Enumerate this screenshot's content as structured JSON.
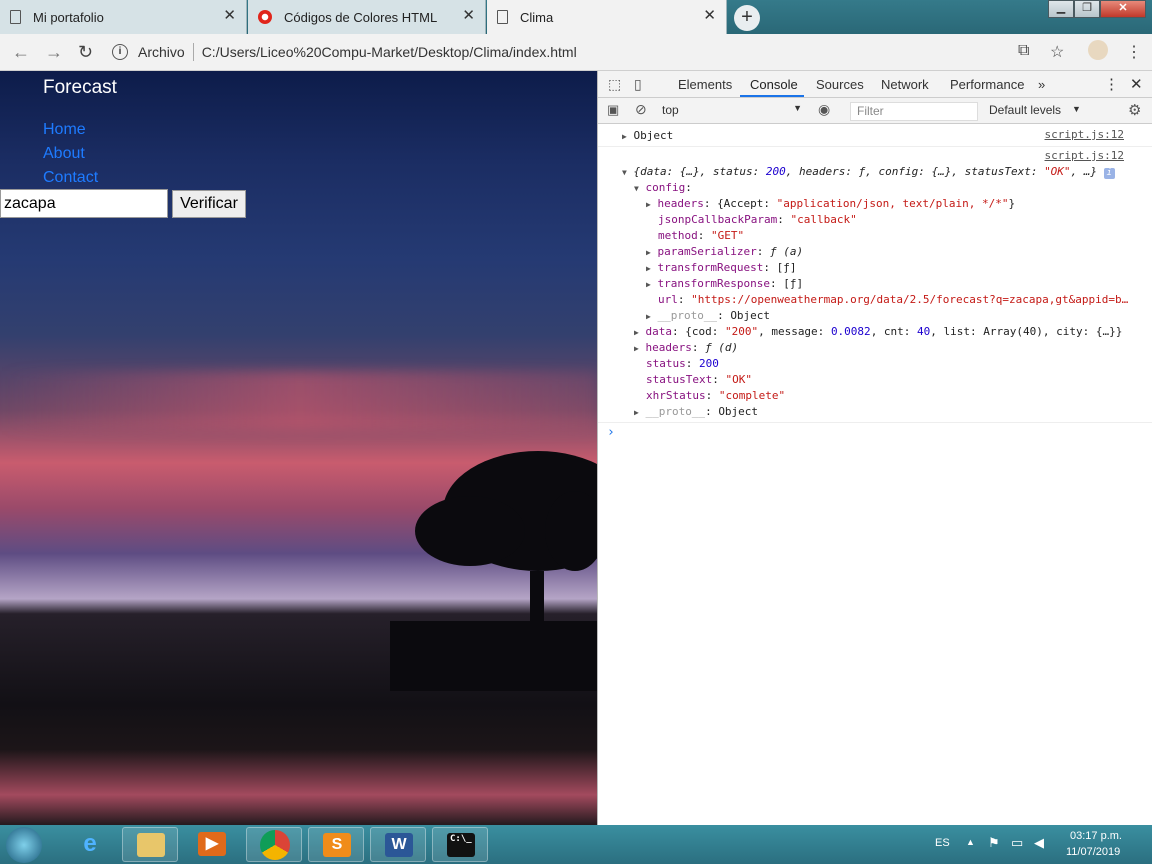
{
  "browser": {
    "tabs": [
      {
        "label": "Mi portafolio",
        "icon": "document-icon"
      },
      {
        "label": "Códigos de Colores HTML",
        "icon": "opera-icon"
      },
      {
        "label": "Clima",
        "icon": "document-icon"
      }
    ],
    "close_glyph": "✕",
    "new_tab_glyph": "+",
    "omnibox": {
      "scheme_label": "Archivo",
      "url": "C:/Users/Liceo%20Compu-Market/Desktop/Clima/index.html"
    }
  },
  "page": {
    "title": "Forecast",
    "nav": [
      "Home",
      "About",
      "Contact"
    ],
    "search_value": "zacapa",
    "button_label": "Verificar"
  },
  "devtools": {
    "tabs": [
      "Elements",
      "Console",
      "Sources",
      "Network",
      "Performance"
    ],
    "active_tab": "Console",
    "context": "top",
    "filter_placeholder": "Filter",
    "levels": "Default levels",
    "messages": {
      "src1": "script.js:12",
      "src2": "script.js:12",
      "line1": "Object",
      "summary_a": "{data: {…}, status: ",
      "summary_b": "200",
      "summary_c": ", headers: ƒ, config: {…}, statusText: ",
      "summary_d": "\"OK\"",
      "summary_e": ", …}",
      "config_key": "config",
      "headers_key": "headers",
      "headers_a": "{Accept: ",
      "headers_b": "\"application/json, text/plain, */*\"",
      "headers_c": "}",
      "jsonp_key": "jsonpCallbackParam",
      "jsonp_val": "\"callback\"",
      "method_key": "method",
      "method_val": "\"GET\"",
      "param_key": "paramSerializer",
      "param_val": "ƒ (a)",
      "treq_key": "transformRequest",
      "treq_val": "[ƒ]",
      "tres_key": "transformResponse",
      "tres_val": "[ƒ]",
      "url_key": "url",
      "url_val": "\"https://openweathermap.org/data/2.5/forecast?q=zacapa,gt&appid=b…",
      "proto_key": "__proto__",
      "proto_val": "Object",
      "data_key": "data",
      "data_a": "{cod: ",
      "data_b": "\"200\"",
      "data_c": ", message: ",
      "data_d": "0.0082",
      "data_e": ", cnt: ",
      "data_f": "40",
      "data_g": ", list: Array(40), city: {…}}",
      "hdr2_key": "headers",
      "hdr2_val": "ƒ (d)",
      "status_key": "status",
      "status_val": "200",
      "stext_key": "statusText",
      "stext_val": "\"OK\"",
      "xhr_key": "xhrStatus",
      "xhr_val": "\"complete\"",
      "proto2_key": "__proto__",
      "proto2_val": "Object"
    }
  },
  "taskbar": {
    "language": "ES",
    "time": "03:17 p.m.",
    "date": "11/07/2019"
  }
}
